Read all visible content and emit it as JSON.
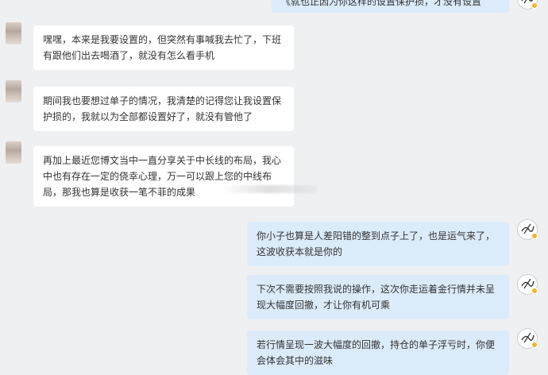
{
  "messages": [
    {
      "direction": "outgoing",
      "text": "《就也正因为你这样的设置保护损，才没有设置"
    },
    {
      "direction": "incoming",
      "text": "嘿嘿，本来是我要设置的，但突然有事喊我去忙了，下班有跟他们出去喝酒了，就没有怎么看手机"
    },
    {
      "direction": "incoming",
      "text": "期间我也要想过单子的情况，我清楚的记得您让我设置保护损的，我就以为全部都设置好了，就没有管他了"
    },
    {
      "direction": "incoming",
      "text": "再加上最近您博文当中一直分享关于中长线的布局，我心中也有存在一定的侥幸心理，万一可以跟上您的中线布局，那我也算是收获一笔不菲的成果"
    },
    {
      "direction": "outgoing",
      "text": "你小子也算是人差阳错的整到点子上了，也是运气来了，这波收获本就是你的"
    },
    {
      "direction": "outgoing",
      "text": "下次不需要按照我说的操作，这次你走运着金行情并未呈现大幅度回撤，才让你有机可乘"
    },
    {
      "direction": "outgoing",
      "text": "若行情呈现一波大幅度的回撤，持仓的单子浮亏时，你便会体会其中的滋味"
    }
  ],
  "colors": {
    "background": "#eff0f2",
    "incoming_bubble": "#ffffff",
    "outgoing_bubble": "#dcebfa",
    "avatar_badge": "#f5b325"
  }
}
